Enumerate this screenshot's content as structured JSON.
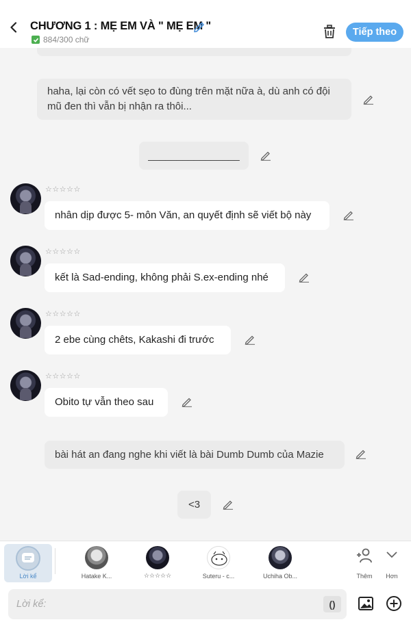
{
  "header": {
    "title": "CHƯƠNG 1 : MẸ EM VÀ \" MẸ EM \"",
    "word_count": "884/300 chữ",
    "follow_label": "Tiếp theo"
  },
  "messages": [
    {
      "text": "haha, lại còn có vết sẹo to đùng trên mặt nữa à, dù anh có đội mũ đen thì vẫn bị nhận ra thôi...",
      "kind": "narration"
    },
    {
      "text": "________________",
      "kind": "narration"
    },
    {
      "text": "nhân dịp được 5- môn Văn, an quyết định sẽ viết bộ này",
      "kind": "character",
      "name": "☆☆☆☆☆"
    },
    {
      "text": "kết là Sad-ending, không phải S.ex-ending nhé",
      "kind": "character",
      "name": "☆☆☆☆☆"
    },
    {
      "text": "2 ebe cùng chêts, Kakashi đi trước",
      "kind": "character",
      "name": "☆☆☆☆☆"
    },
    {
      "text": "Obito tự vẫn theo sau",
      "kind": "character",
      "name": "☆☆☆☆☆"
    },
    {
      "text": "bài hát an đang nghe khi viết là bài Dumb Dumb của Mazie",
      "kind": "narration"
    },
    {
      "text": "<3",
      "kind": "narration"
    }
  ],
  "character_bar": {
    "items": [
      {
        "label": "Lời kể",
        "icon": "narrator-icon"
      },
      {
        "label": "Hatake K...",
        "icon": "avatar"
      },
      {
        "label": "☆☆☆☆☆",
        "icon": "avatar"
      },
      {
        "label": "Suteru - c...",
        "icon": "avatar"
      },
      {
        "label": "Uchiha Ob...",
        "icon": "avatar"
      }
    ],
    "add_label": "Thêm",
    "more_label": "Hơn"
  },
  "input": {
    "placeholder": "Lời kể:",
    "paren_label": "()"
  },
  "colors": {
    "accent": "#5aa9ee",
    "background": "#f4f4f4",
    "bubble_narration": "#ebebeb",
    "bubble_character": "#ffffff"
  }
}
